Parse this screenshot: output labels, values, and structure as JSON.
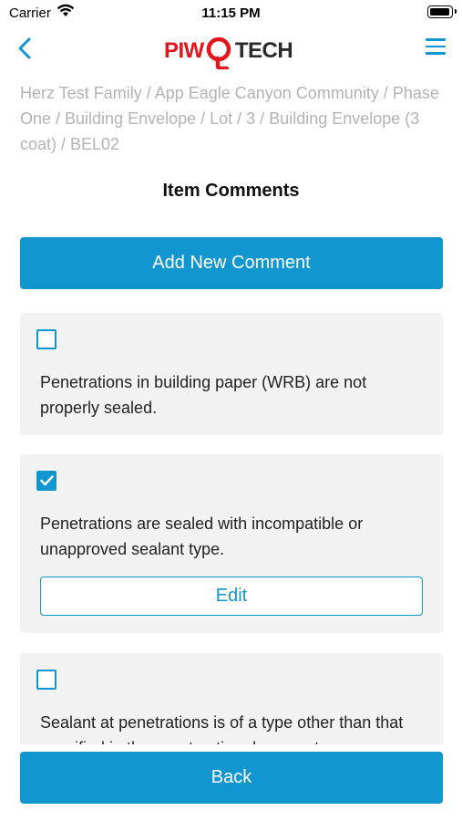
{
  "status_bar": {
    "carrier": "Carrier",
    "time": "11:15 PM"
  },
  "header": {
    "logo_piw": "PIW",
    "logo_tech": "TECH",
    "brand_red": "#e3151d",
    "accent": "#1296cf"
  },
  "breadcrumb": "Herz Test Family / App Eagle Canyon Community / Phase One / Building Envelope / Lot / 3 / Building Envelope (3 coat) / BEL02",
  "page_title": "Item Comments",
  "add_button_label": "Add New Comment",
  "comments": [
    {
      "text": "Penetrations in building paper (WRB) are not properly sealed.",
      "checked": false
    },
    {
      "text": "Penetrations are sealed with incompatible or unapproved sealant type.",
      "checked": true,
      "edit_label": "Edit"
    },
    {
      "text": "Sealant at penetrations is of a type other than that specified in the construction documents.",
      "checked": false
    }
  ],
  "back_button_label": "Back"
}
